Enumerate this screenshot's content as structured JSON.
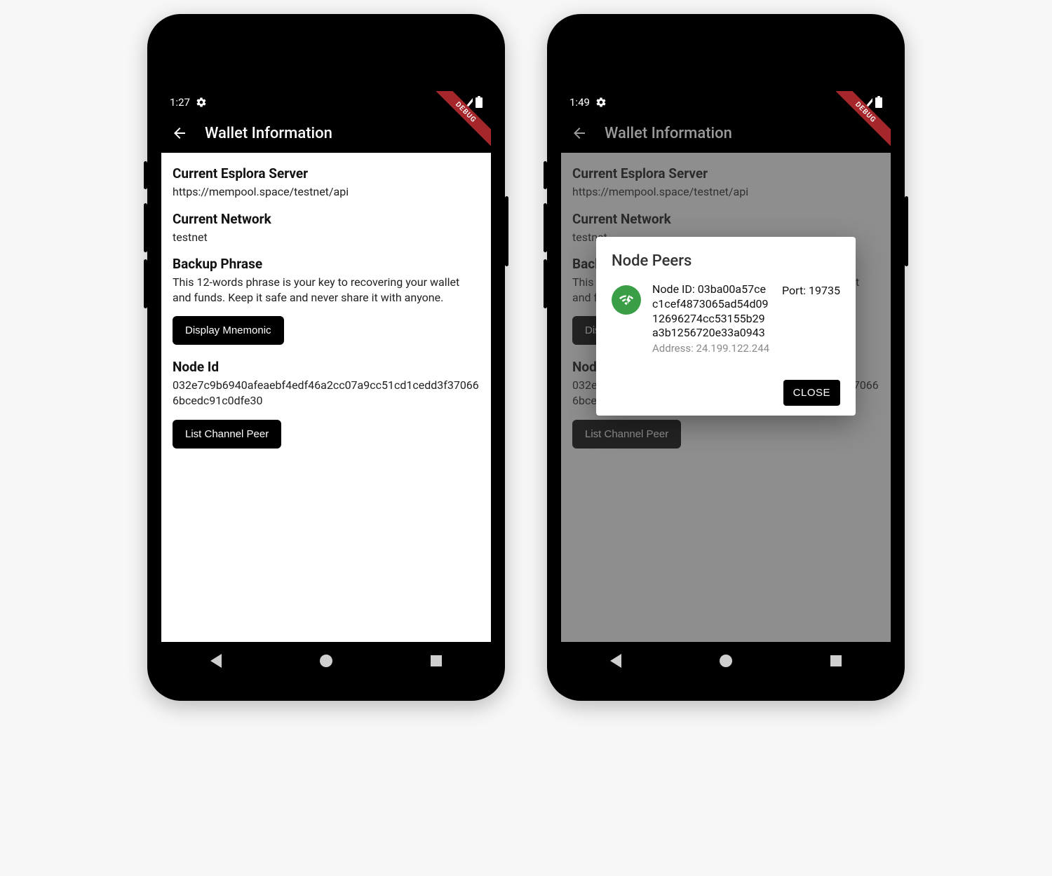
{
  "debug_ribbon": "DEBUG",
  "screens": {
    "left": {
      "status_time": "1:27",
      "app_title": "Wallet Information"
    },
    "right": {
      "status_time": "1:49",
      "app_title": "Wallet Information"
    }
  },
  "content": {
    "esplora_title": "Current Esplora Server",
    "esplora_value": "https://mempool.space/testnet/api",
    "network_title": "Current Network",
    "network_value": "testnet",
    "backup_title": "Backup Phrase",
    "backup_body": "This 12-words phrase is your key to recovering your wallet and funds. Keep it safe and never share it with anyone.",
    "mnemonic_button": "Display Mnemonic",
    "node_id_title": "Node Id",
    "node_id_value": "032e7c9b6940afeaebf4edf46a2cc07a9cc51cd1cedd3f370666bcedc91c0dfe30",
    "list_peer_button": "List Channel Peer"
  },
  "dialog": {
    "title": "Node Peers",
    "node_id_label": "Node ID: ",
    "node_id": "03ba00a57cec1cef4873065ad54d0912696274cc53155b29a3b1256720e33a0943",
    "address_label": "Address: ",
    "address": "24.199.122.244",
    "port_label": "Port: ",
    "port": "19735",
    "close": "CLOSE"
  }
}
